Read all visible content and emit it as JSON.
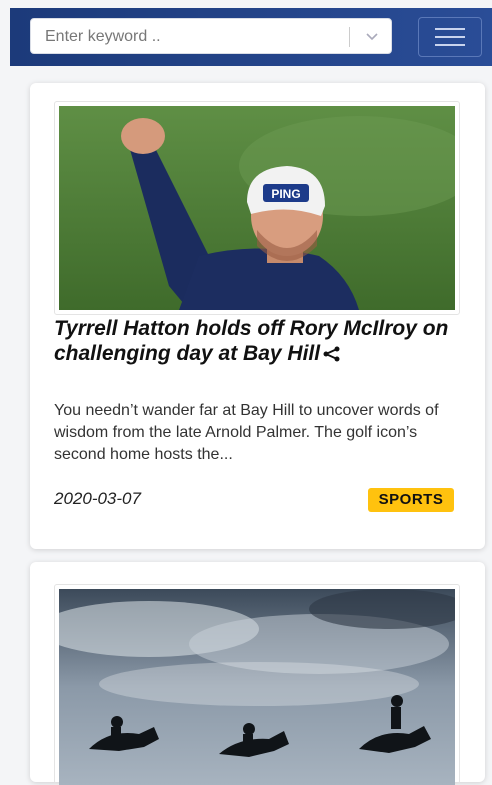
{
  "search": {
    "placeholder": "Enter keyword .."
  },
  "header": {
    "menu_icon": "hamburger-icon",
    "dropdown_icon": "chevron-down-icon"
  },
  "articles": [
    {
      "title": "Tyrrell Hatton holds off Rory McIlroy on challenging day at Bay Hill",
      "excerpt": "You needn’t wander far at Bay Hill to uncover words of wisdom from the late Arnold Palmer. The golf icon’s second home hosts the...",
      "date": "2020-03-07",
      "category": "SPORTS",
      "cap_text": "PING",
      "share_icon": "share-icon"
    },
    {
      "image": "horse-racing-silhouettes"
    }
  ],
  "colors": {
    "header": "#1f3f83",
    "badge": "#ffc20e"
  }
}
